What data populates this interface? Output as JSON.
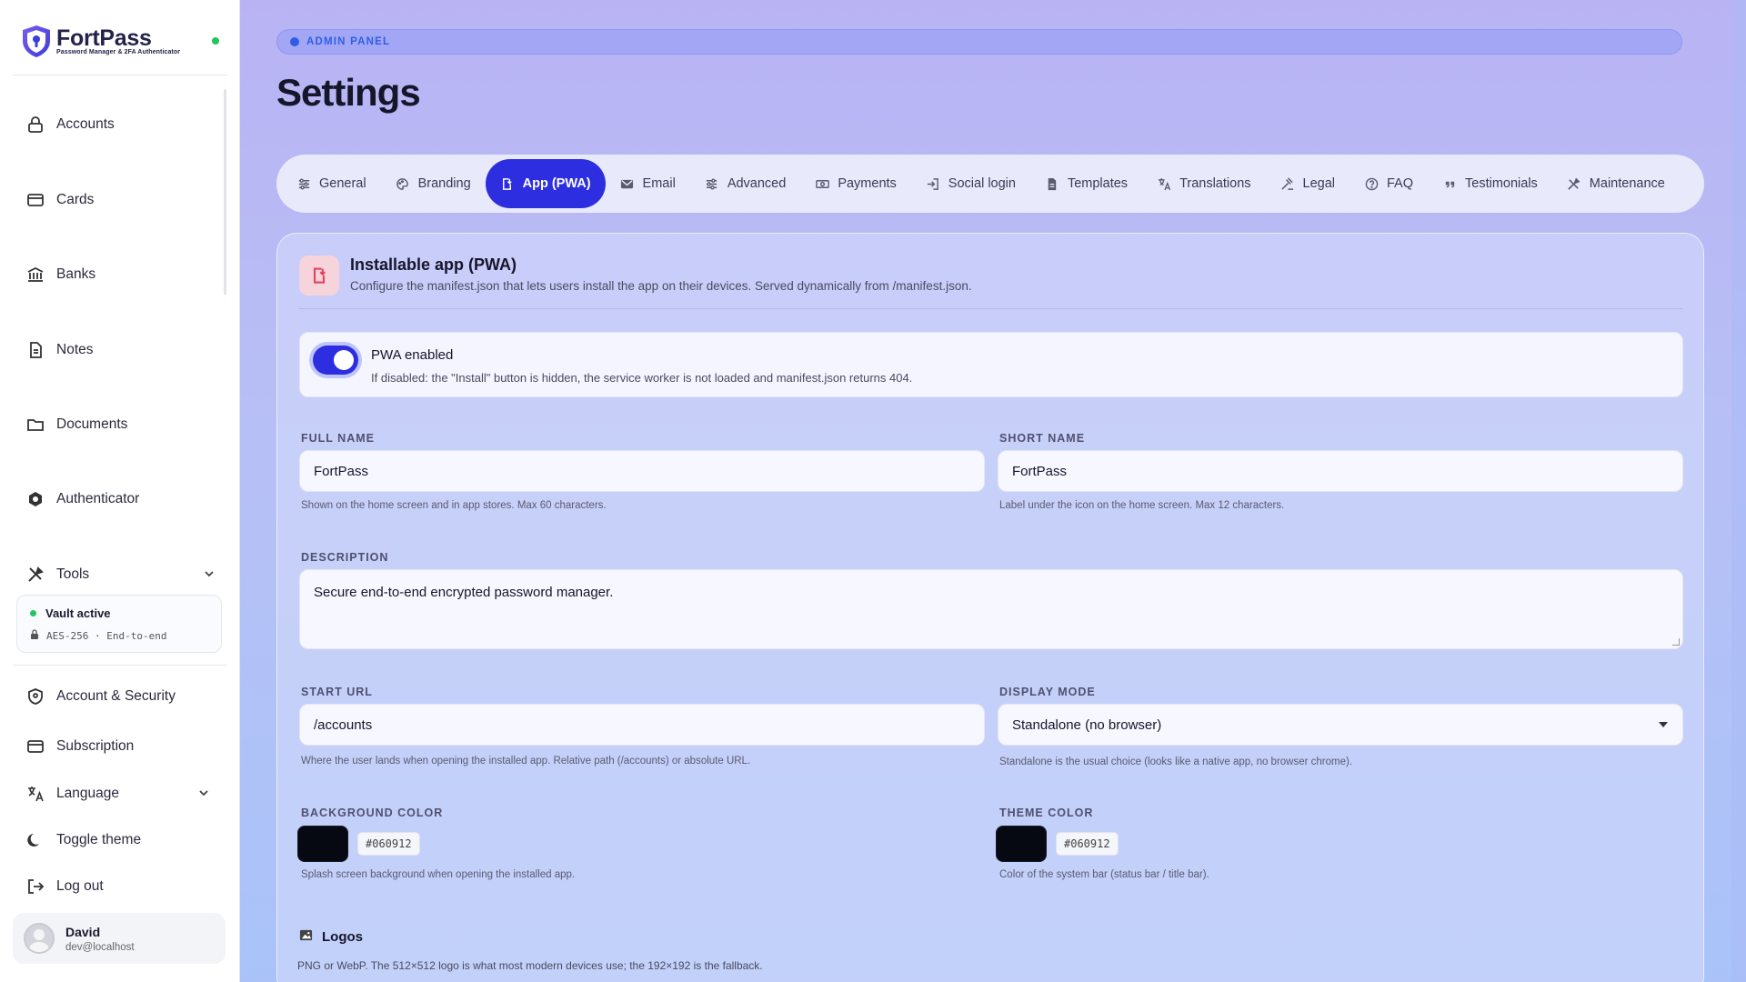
{
  "brand": {
    "name": "FortPass",
    "tagline": "Password Manager & 2FA Authenticator"
  },
  "sidebar": {
    "items": [
      {
        "label": "Accounts",
        "icon": "lock-bag-icon"
      },
      {
        "label": "Cards",
        "icon": "card-icon"
      },
      {
        "label": "Banks",
        "icon": "bank-icon"
      },
      {
        "label": "Notes",
        "icon": "note-icon"
      },
      {
        "label": "Documents",
        "icon": "folder-icon"
      },
      {
        "label": "Authenticator",
        "icon": "authenticator-icon"
      },
      {
        "label": "Tools",
        "icon": "tools-icon"
      }
    ],
    "vault": {
      "status": "Vault active",
      "meta": "AES-256 · End-to-end"
    },
    "bottom_items": [
      {
        "label": "Account & Security",
        "icon": "shield-icon"
      },
      {
        "label": "Subscription",
        "icon": "card-icon"
      },
      {
        "label": "Language",
        "icon": "translate-icon"
      },
      {
        "label": "Toggle theme",
        "icon": "moon-icon"
      },
      {
        "label": "Log out",
        "icon": "logout-icon"
      }
    ],
    "user": {
      "name": "David",
      "email": "dev@localhost"
    }
  },
  "header": {
    "badge": "ADMIN PANEL",
    "title": "Settings"
  },
  "tabs": [
    {
      "label": "General",
      "active": false
    },
    {
      "label": "Branding",
      "active": false
    },
    {
      "label": "App (PWA)",
      "active": true
    },
    {
      "label": "Email",
      "active": false
    },
    {
      "label": "Advanced",
      "active": false
    },
    {
      "label": "Payments",
      "active": false
    },
    {
      "label": "Social login",
      "active": false
    },
    {
      "label": "Templates",
      "active": false
    },
    {
      "label": "Translations",
      "active": false
    },
    {
      "label": "Legal",
      "active": false
    },
    {
      "label": "FAQ",
      "active": false
    },
    {
      "label": "Testimonials",
      "active": false
    },
    {
      "label": "Maintenance",
      "active": false
    }
  ],
  "section": {
    "title": "Installable app (PWA)",
    "description": "Configure the manifest.json that lets users install the app on their devices. Served dynamically from /manifest.json.",
    "pwa": {
      "label": "PWA enabled",
      "hint": "If disabled: the \"Install\" button is hidden, the service worker is not loaded and manifest.json returns 404.",
      "enabled": true
    },
    "full_name": {
      "label": "FULL NAME",
      "value": "FortPass",
      "hint": "Shown on the home screen and in app stores. Max 60 characters."
    },
    "short_name": {
      "label": "SHORT NAME",
      "value": "FortPass",
      "hint": "Label under the icon on the home screen. Max 12 characters."
    },
    "description_field": {
      "label": "DESCRIPTION",
      "value": "Secure end-to-end encrypted password manager."
    },
    "start_url": {
      "label": "START URL",
      "value": "/accounts",
      "hint": "Where the user lands when opening the installed app. Relative path (/accounts) or absolute URL."
    },
    "display_mode": {
      "label": "DISPLAY MODE",
      "value": "Standalone (no browser)",
      "hint": "Standalone is the usual choice (looks like a native app, no browser chrome)."
    },
    "background_color": {
      "label": "BACKGROUND COLOR",
      "value": "#060912",
      "hint": "Splash screen background when opening the installed app."
    },
    "theme_color": {
      "label": "THEME COLOR",
      "value": "#060912",
      "hint": "Color of the system bar (status bar / title bar)."
    },
    "logos": {
      "title": "Logos",
      "hint": "PNG or WebP. The 512×512 logo is what most modern devices use; the 192×192 is the fallback."
    }
  },
  "colors": {
    "accent": "#2c2ee0",
    "online": "#22c55e",
    "badge": "#2f5ee6",
    "section_icon": "#e0445f"
  }
}
